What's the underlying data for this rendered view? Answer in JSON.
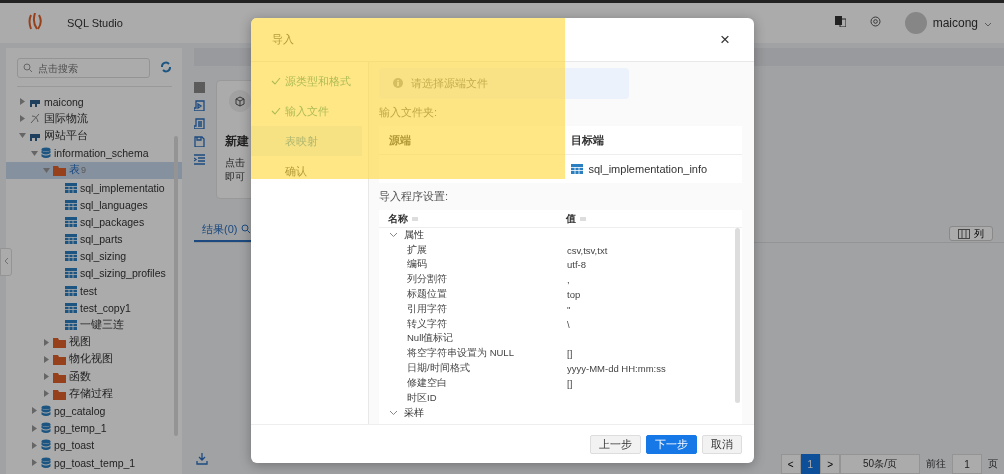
{
  "app": {
    "title": "SQL Studio",
    "user": "maicong",
    "search": {
      "placeholder": "点击搜索"
    }
  },
  "tree": [
    {
      "label": "maicong",
      "kind": "server",
      "expanded": false,
      "selected": false
    },
    {
      "label": "国际物流",
      "kind": "link",
      "expanded": false,
      "selected": false
    },
    {
      "label": "网站平台",
      "kind": "server",
      "expanded": true,
      "selected": false,
      "children": [
        {
          "label": "information_schema",
          "kind": "database",
          "expanded": true,
          "selected": false,
          "children": [
            {
              "label": "表",
              "count": "9",
              "kind": "folder",
              "expanded": true,
              "selected": true,
              "children": [
                {
                  "label": "sql_implementatio",
                  "kind": "table",
                  "selected": false
                },
                {
                  "label": "sql_languages",
                  "kind": "table",
                  "selected": false
                },
                {
                  "label": "sql_packages",
                  "kind": "table",
                  "selected": false
                },
                {
                  "label": "sql_parts",
                  "kind": "table",
                  "selected": false
                },
                {
                  "label": "sql_sizing",
                  "kind": "table",
                  "selected": false
                },
                {
                  "label": "sql_sizing_profiles",
                  "kind": "table",
                  "selected": false
                },
                {
                  "label": "test",
                  "kind": "table",
                  "selected": false
                },
                {
                  "label": "test_copy1",
                  "kind": "table",
                  "selected": false
                },
                {
                  "label": "一键三连",
                  "kind": "table",
                  "selected": false
                }
              ]
            },
            {
              "label": "视图",
              "kind": "folder",
              "expanded": false,
              "selected": false
            },
            {
              "label": "物化视图",
              "kind": "folder",
              "expanded": false,
              "selected": false
            },
            {
              "label": "函数",
              "kind": "folder",
              "expanded": false,
              "selected": false
            },
            {
              "label": "存储过程",
              "kind": "folder",
              "expanded": false,
              "selected": false
            }
          ]
        },
        {
          "label": "pg_catalog",
          "kind": "database",
          "expanded": false,
          "selected": false
        },
        {
          "label": "pg_temp_1",
          "kind": "database",
          "expanded": false,
          "selected": false
        },
        {
          "label": "pg_toast",
          "kind": "database",
          "expanded": false,
          "selected": false
        },
        {
          "label": "pg_toast_temp_1",
          "kind": "database",
          "expanded": false,
          "selected": false
        }
      ]
    }
  ],
  "card": {
    "title": "新建",
    "lines": [
      "点击",
      "即可"
    ]
  },
  "results": {
    "tabs": [
      {
        "label": "结果(0)",
        "selected": true
      }
    ],
    "columns_button": "列"
  },
  "pagination": {
    "prev": "<",
    "pages": [
      {
        "label": "1",
        "selected": true
      }
    ],
    "next": ">",
    "page_size": "50条/页",
    "goto": "前往",
    "goto_value": "1",
    "page_unit": "页"
  },
  "dialog": {
    "title": "导入",
    "close": "×",
    "steps": [
      {
        "label": "源类型和格式",
        "done": true,
        "selected": false
      },
      {
        "label": "输入文件",
        "done": true,
        "selected": false
      },
      {
        "label": "表映射",
        "done": false,
        "selected": true
      },
      {
        "label": "确认",
        "done": false,
        "selected": false
      }
    ],
    "alert": "请选择源端文件",
    "folder_label": "输入文件夹:",
    "mapping": {
      "columns": [
        "源端",
        "目标端"
      ],
      "rows": [
        [
          "",
          "sql_implementation_info"
        ]
      ]
    },
    "settings_label": "导入程序设置:",
    "settings": {
      "columns": [
        "名称",
        "值"
      ],
      "groups": [
        {
          "label": "属性",
          "expanded": true,
          "rows": [
            [
              "扩展",
              "csv,tsv,txt"
            ],
            [
              "编码",
              "utf-8"
            ],
            [
              "列分割符",
              ","
            ],
            [
              "标题位置",
              "top"
            ],
            [
              "引用字符",
              "\""
            ],
            [
              "转义字符",
              "\\"
            ],
            [
              "Null值标记",
              ""
            ],
            [
              "将空字符串设置为 NULL",
              "[]"
            ],
            [
              "日期/时间格式",
              "yyyy-MM-dd HH:mm:ss"
            ],
            [
              "修建空白",
              "[]"
            ],
            [
              "时区ID",
              ""
            ]
          ]
        },
        {
          "label": "采样",
          "expanded": true
        }
      ]
    },
    "buttons": [
      {
        "label": "上一步",
        "kind": "default"
      },
      {
        "label": "下一步",
        "kind": "primary"
      },
      {
        "label": "取消",
        "kind": "default"
      }
    ]
  },
  "highlight_box": true
}
